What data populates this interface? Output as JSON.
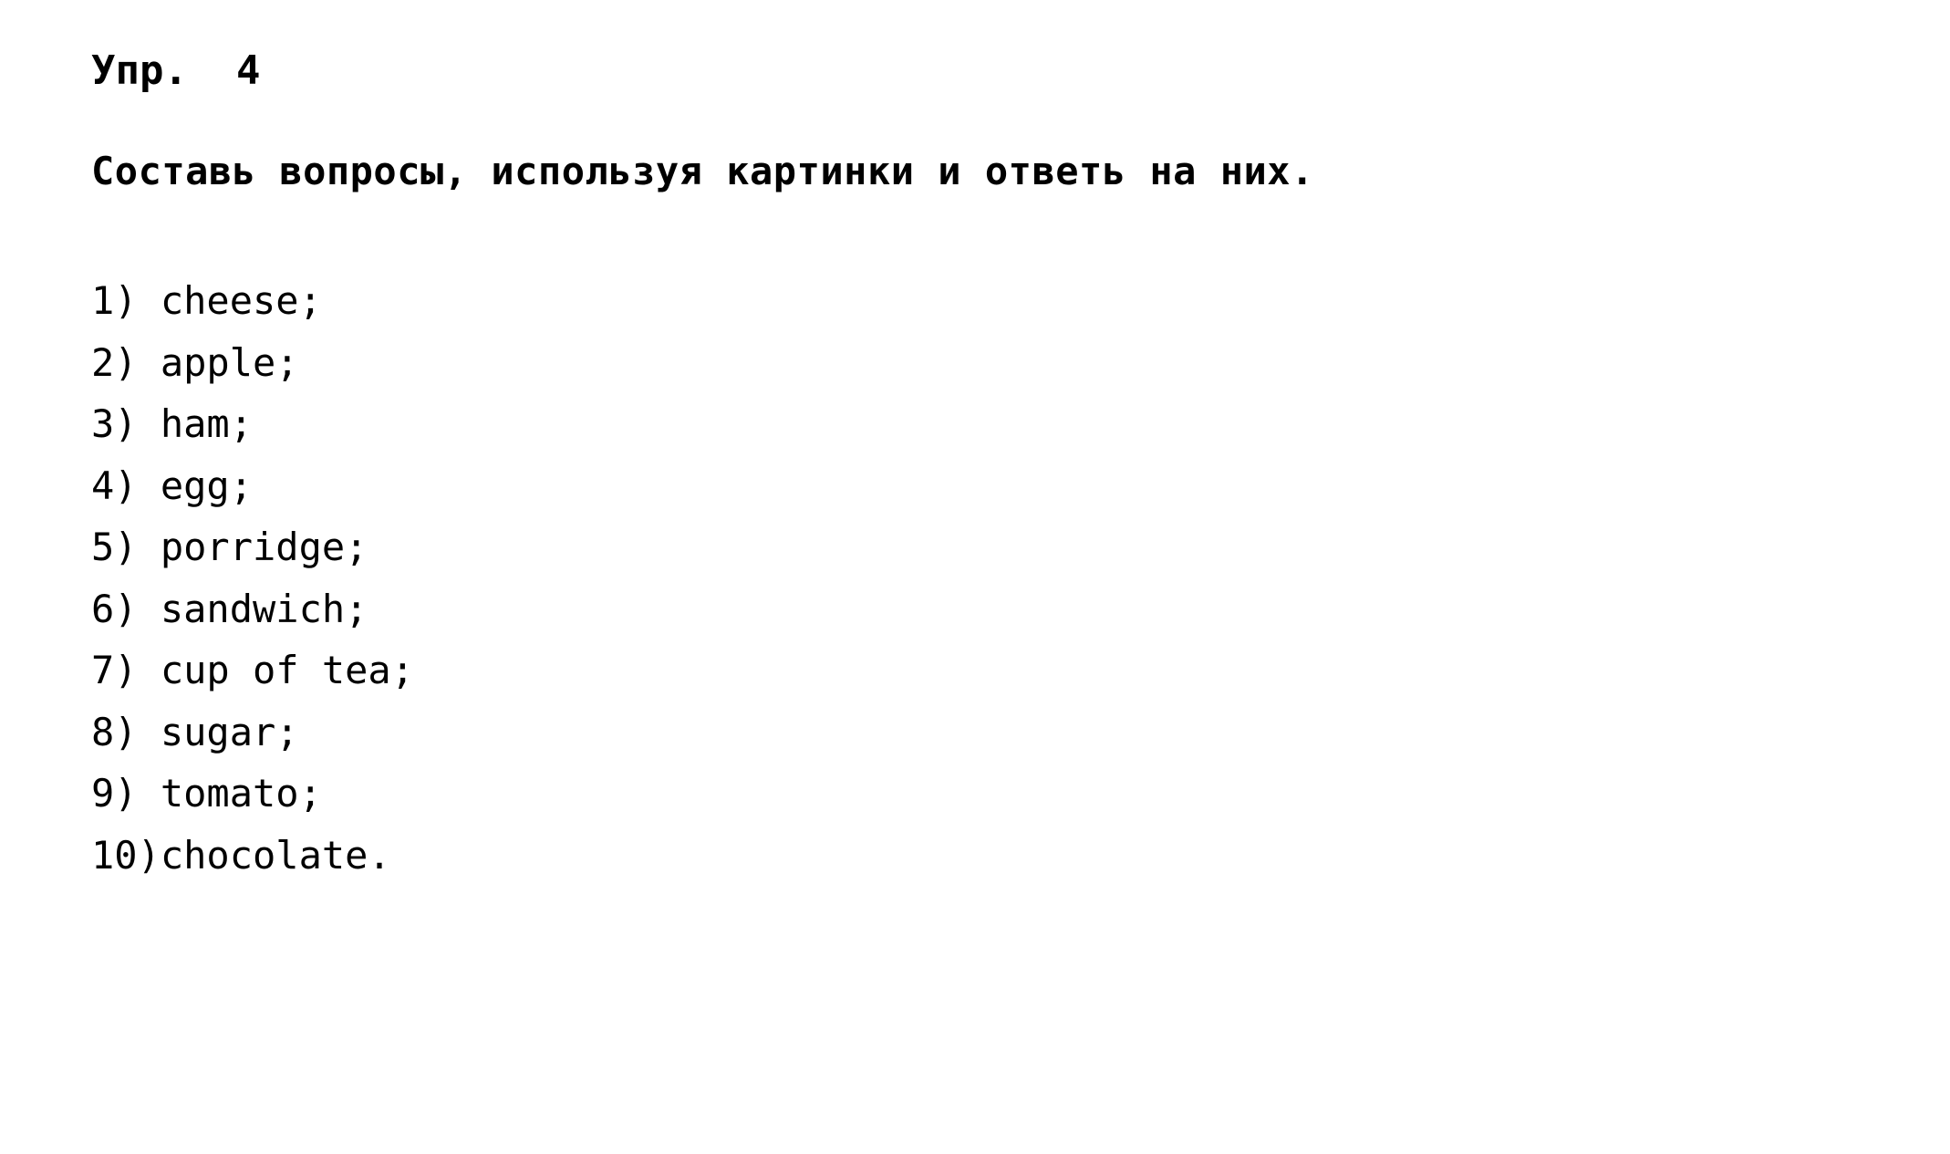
{
  "document": {
    "background_color": "#ffffff",
    "text_color": "#000000",
    "heading": "Упр.  4",
    "instruction": "Составь вопросы, используя картинки и ответь на них.",
    "items": [
      {
        "number": "1) ",
        "text": "cheese;"
      },
      {
        "number": "2) ",
        "text": "apple;"
      },
      {
        "number": "3) ",
        "text": "ham;"
      },
      {
        "number": "4) ",
        "text": "egg;"
      },
      {
        "number": "5) ",
        "text": "porridge;"
      },
      {
        "number": "6) ",
        "text": "sandwich;"
      },
      {
        "number": "7) ",
        "text": "cup of tea;"
      },
      {
        "number": "8) ",
        "text": "sugar;"
      },
      {
        "number": "9) ",
        "text": "tomato;"
      },
      {
        "number": "10)",
        "text": "chocolate."
      }
    ]
  }
}
